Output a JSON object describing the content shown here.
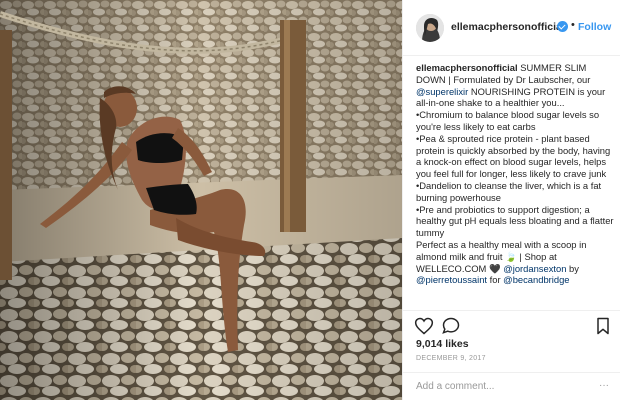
{
  "post": {
    "photo_alt": "Woman in black bikini reclining on a stone wall",
    "header": {
      "username": "ellemacphersonofficial",
      "separator": "•",
      "follow_label": "Follow"
    },
    "caption": {
      "username": "ellemacphersonofficial",
      "lines": [
        "SUMMER SLIM DOWN | Formulated by Dr Laubscher, our ",
        "@superelixir",
        " NOURISHING PROTEIN is your all-in-one shake to a healthier you...",
        "•Chromium to balance blood sugar levels so you're less likely to eat carbs",
        "•Pea & sprouted rice protein - plant based protein is quickly absorbed by the body, having a knock-on effect on blood sugar levels, helps you feel full for longer, less likely to crave junk",
        "•Dandelion to cleanse the liver, which is a fat burning powerhouse",
        "•Pre and probiotics to support digestion; a healthy gut pH equals less bloating and a flatter tummy",
        "Perfect as a healthy meal with a scoop in almond milk and fruit ",
        "🍃",
        " | Shop at WELLECO.COM ",
        "🖤",
        "@jordansexton",
        " by ",
        "@pierretoussaint",
        " for ",
        "@becandbridge"
      ]
    },
    "likes": "9,014 likes",
    "date": "DECEMBER 9, 2017",
    "comment_placeholder": "Add a comment...",
    "more": "···",
    "icons": {
      "like": "heart-icon",
      "comment": "comment-icon",
      "save": "bookmark-icon",
      "verified": "verified-badge-icon"
    },
    "colors": {
      "link": "#003569",
      "follow": "#3897f0",
      "text": "#262626",
      "muted": "#999999"
    }
  }
}
